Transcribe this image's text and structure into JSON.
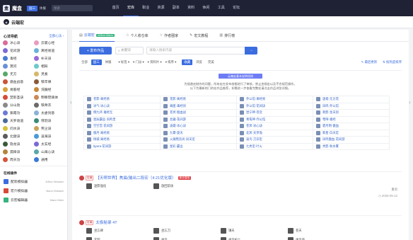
{
  "topbar": {
    "logo": "魔盒",
    "servers": [
      "国三",
      "体服"
    ],
    "active_server": "国三",
    "search_placeholder": "搜索",
    "nav": [
      "首页",
      "宏库",
      "职业",
      "资源",
      "副本",
      "资料",
      "休闲",
      "工具",
      "论坛"
    ],
    "active_nav": "宏库"
  },
  "subbar": {
    "title": "云端宏"
  },
  "sidebar": {
    "heading": "心法导航",
    "more": "全部心法 ›",
    "sects": [
      {
        "label": "冰心诀",
        "color": "#d96b9a"
      },
      {
        "label": "云裳心经",
        "color": "#e89cc0"
      },
      {
        "label": "花间游",
        "color": "#7b6bd6"
      },
      {
        "label": "离经易道",
        "color": "#6bb3d6"
      },
      {
        "label": "毒经",
        "color": "#4a7bd1"
      },
      {
        "label": "补天诀",
        "color": "#9a6bd6"
      },
      {
        "label": "莫问",
        "color": "#6b8fd6"
      },
      {
        "label": "相知",
        "color": "#6bc9c9"
      },
      {
        "label": "无方",
        "color": "#5aa86b"
      },
      {
        "label": "灵素",
        "color": "#d6b86b"
      },
      {
        "label": "傲血战意",
        "color": "#c9553a"
      },
      {
        "label": "铁牢律",
        "color": "#8a5a3a"
      },
      {
        "label": "易筋经",
        "color": "#d9a23a"
      },
      {
        "label": "洗髓经",
        "color": "#c9883a"
      },
      {
        "label": "焚影圣诀",
        "color": "#d64a3a"
      },
      {
        "label": "明尊琉璃体",
        "color": "#c98a5a"
      },
      {
        "label": "分山劲",
        "color": "#8a8a8a"
      },
      {
        "label": "铁骨衣",
        "color": "#6a6a6a"
      },
      {
        "label": "紫霞功",
        "color": "#6a7bd6"
      },
      {
        "label": "太虚剑意",
        "color": "#8ab3d6"
      },
      {
        "label": "天罗诡道",
        "color": "#4a6a9a"
      },
      {
        "label": "惊羽诀",
        "color": "#3a8a7a"
      },
      {
        "label": "问水诀",
        "color": "#d6c23a"
      },
      {
        "label": "笑尘诀",
        "color": "#c9a35a"
      },
      {
        "label": "北傲诀",
        "color": "#5a5a5a"
      },
      {
        "label": "凌海诀",
        "color": "#4a9ad6"
      },
      {
        "label": "隐龙诀",
        "color": "#3a5a3a"
      },
      {
        "label": "太玄经",
        "color": "#7a6ad6"
      },
      {
        "label": "孤锋诀",
        "color": "#b3853a"
      },
      {
        "label": "山海心诀",
        "color": "#5aa8a8"
      },
      {
        "label": "周天功",
        "color": "#d6553a"
      },
      {
        "label": "通用",
        "color": "#3a7ad6"
      }
    ],
    "tools_heading": "在线插件",
    "tools": [
      {
        "name": "配装模拟器",
        "en": "Jx3box Simulator",
        "color": "#3b6de0"
      },
      {
        "name": "宏介模拟器",
        "en": "Macro Simulator",
        "color": "#d64a3a"
      },
      {
        "name": "云宏编辑器",
        "en": "Macro Editor",
        "color": "#36b37e"
      }
    ]
  },
  "tabs": [
    {
      "label": "云端宏",
      "badge": "Jx3box Macro",
      "active": true,
      "icon": "▤"
    },
    {
      "label": "个人收仓库",
      "badge": "",
      "active": false,
      "icon": "☆"
    },
    {
      "label": "作者圈家",
      "badge": "",
      "active": false,
      "icon": "☆"
    },
    {
      "label": "宏文教程",
      "badge": "",
      "active": false,
      "icon": "✎"
    },
    {
      "label": "排行榜",
      "badge": "",
      "active": false,
      "icon": "▥"
    }
  ],
  "toolbar": {
    "publish": "+ 发布作品",
    "keyword_label": "关键词",
    "search_placeholder": "请输入搜索内容",
    "go": "→"
  },
  "filters": {
    "chips": [
      "全部",
      "国三",
      "体服"
    ],
    "active_chip": "国三",
    "dropdowns": [
      "▾ 标签 ▾",
      "▾ 门派 ▾",
      "▾ 资料片 ▾",
      "▾ 排序 ▾"
    ],
    "toggles": [
      "收藏",
      "浏览",
      "完美"
    ],
    "active_toggle": "收藏",
    "right": [
      "✎ 最后更新",
      "⇅ 按热度排序"
    ]
  },
  "notice": {
    "title": "云端宏基本说明须知",
    "lines": [
      "为规避宏制作的问题，所有宏在发布前都进行了审核，禁止违规宏以及不合规范操作。",
      "以下为最新热门的宏作品推荐，如需进一步查看完整宏请点击作品浏览详细。"
    ]
  },
  "macro_grid": [
    "苍影·离经易",
    "花影·离经易",
    "乔公馆·离经易",
    "迷墟·无方花",
    "冰气·冰心诀",
    "离匿·毒经剑",
    "乔公馆·花间诀",
    "凤鸣·乔公馆",
    "倒九环·毒经无",
    "苍冥·傲血战",
    "昆宁神·苍云",
    "刺影·金天剑",
    "星辰霸业·凤鸣皇",
    "北疆·花间游",
    "青鸾神·乔公馆",
    "莺啼·毒经",
    "空空宫·花间游",
    "凌霜·冰心诀",
    "苍冥·冰心诀",
    "碧月明·傲血",
    "傲月·离经易",
    "九霄·旋天",
    "北冥·天罗诡",
    "新星·白天宏",
    "倾城·离经易",
    "火漏熊云尚·凤天宏",
    "凌鸟·刀宗宏",
    "凤鸣傲血·花间游",
    "bjarra·花间游",
    "星彩·霸业",
    "七秀宏·叶火",
    "秀影·秋水雾"
  ],
  "posts": [
    {
      "tag": "宏编",
      "title": "【天啊世界】焦晨(输出二段宏（4.21优化版）",
      "new": "新手易用",
      "items": [
        "迷影强化",
        "放回前攻"
      ],
      "author": "重剑",
      "date": "2025-05-12"
    },
    {
      "tag": "宏编",
      "title": "太极秘录 4T",
      "new": "",
      "items": [
        "坐忘碑",
        "坐忘刀",
        "镇天",
        "苍天",
        "玄踪",
        "坐伞",
        "坐伞护上",
        "坐伞逝"
      ],
      "author": "CetoRKe",
      "date": "2025-05-12"
    }
  ]
}
